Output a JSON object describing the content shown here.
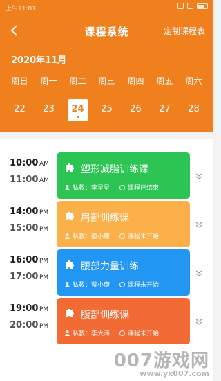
{
  "status": {
    "time": "上午11:01"
  },
  "nav": {
    "title": "课程系统",
    "custom_label": "定制课程表"
  },
  "calendar": {
    "month": "2020年11月",
    "weekdays": [
      "周日",
      "周一",
      "周二",
      "周三",
      "周四",
      "周五",
      "周六"
    ],
    "dates": [
      "22",
      "23",
      "24",
      "25",
      "26",
      "27",
      "28"
    ],
    "selected_index": 2
  },
  "colors": {
    "header": "#f07f1e"
  },
  "courses": [
    {
      "start": "10:00",
      "start_ap": "AM",
      "end": "11:00",
      "end_ap": "AM",
      "name": "塑形减脂训练课",
      "coach": "私教：李星星",
      "status": "课程已结束",
      "color": "#2cc452"
    },
    {
      "start": "14:00",
      "start_ap": "PM",
      "end": "15:00",
      "end_ap": "PM",
      "name": "肩部训练课",
      "coach": "私教：蔡小康",
      "status": "课程未开始",
      "color": "#fbb04a"
    },
    {
      "start": "16:00",
      "start_ap": "PM",
      "end": "17:00",
      "end_ap": "PM",
      "name": "腰部力量训练",
      "coach": "私教：蔡小康",
      "status": "课程未开始",
      "color": "#2196f3"
    },
    {
      "start": "19:00",
      "start_ap": "PM",
      "end": "20:00",
      "end_ap": "PM",
      "name": "腹部训练课",
      "coach": "私教：李大海",
      "status": "课程未开始",
      "color": "#f26a34"
    }
  ],
  "watermark": {
    "main": "007游戏网",
    "sub": "www.yx007.com"
  }
}
